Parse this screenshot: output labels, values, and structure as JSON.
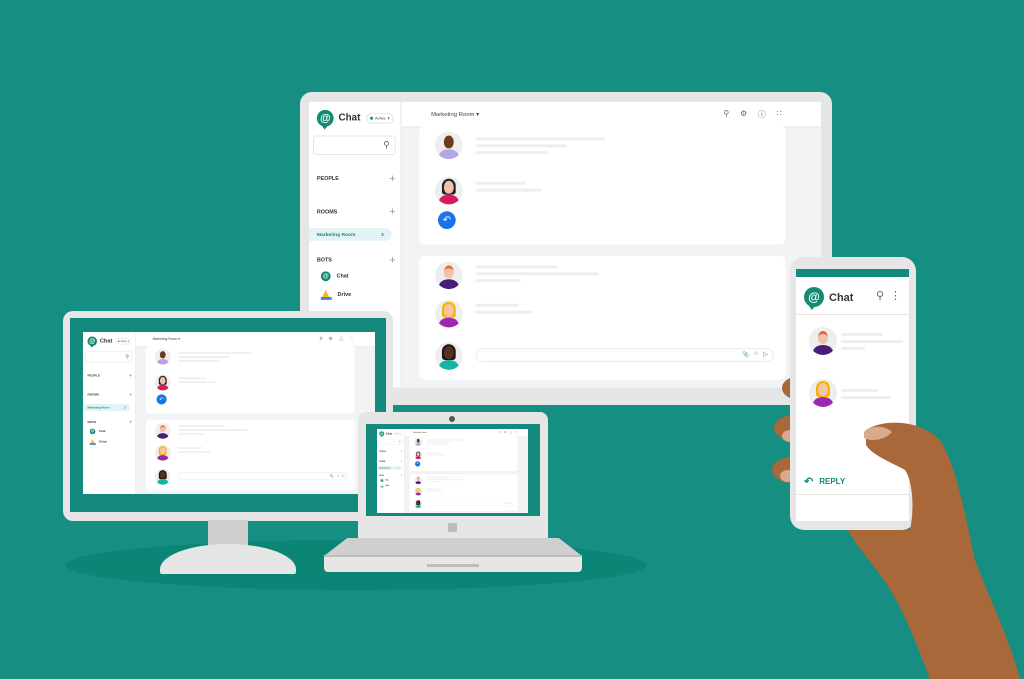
{
  "scene": {
    "background_color": "#168E82",
    "accent_color": "#138A7D",
    "devices": [
      "desktop-monitor",
      "small-monitor",
      "laptop",
      "phone"
    ]
  },
  "app": {
    "brand_name": "Chat",
    "status_label": "Active",
    "search_icon": "search-icon",
    "sections": {
      "people": "PEOPLE",
      "rooms": "ROOMS",
      "bots": "BOTS"
    },
    "rooms": [
      {
        "label": "Marketing Room",
        "unread": "2"
      }
    ],
    "bots": [
      {
        "label": "Chat",
        "icon": "chat-logo-icon"
      },
      {
        "label": "Drive",
        "icon": "drive-icon"
      }
    ],
    "header": {
      "room_title": "Marketing Room",
      "dropdown_icon": "▾",
      "icons": [
        "search-icon",
        "settings-icon",
        "help-icon",
        "apps-grid-icon"
      ]
    },
    "compose_icons": [
      "attach-icon",
      "emoji-icon",
      "send-icon"
    ]
  },
  "phone": {
    "title": "Chat",
    "reply_label": "REPLY",
    "icons": [
      "search-icon",
      "more-vert-icon"
    ]
  }
}
